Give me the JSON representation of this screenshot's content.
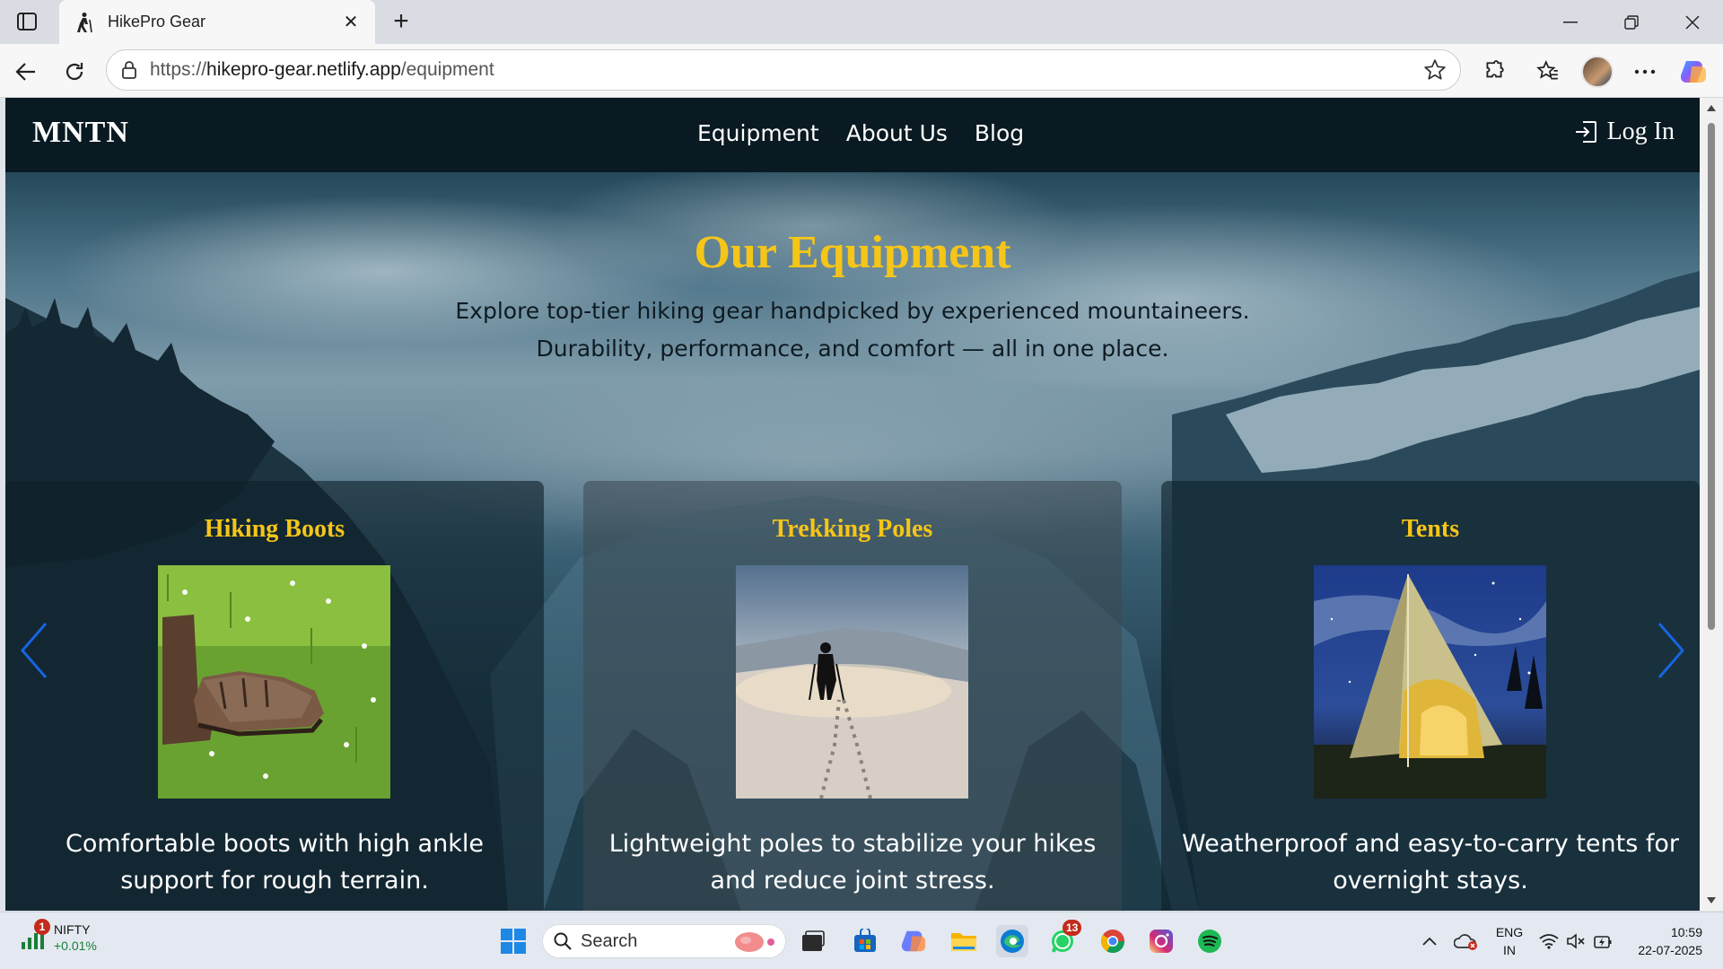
{
  "browser": {
    "tab_title": "HikePro Gear",
    "url_scheme": "https://",
    "url_host": "hikepro-gear.netlify.app",
    "url_path": "/equipment"
  },
  "site": {
    "logo": "MNTN",
    "nav": [
      "Equipment",
      "About Us",
      "Blog"
    ],
    "login_label": "Log In"
  },
  "hero": {
    "title": "Our Equipment",
    "subtitle_line1": "Explore top-tier hiking gear handpicked by experienced mountaineers.",
    "subtitle_line2": "Durability, performance, and comfort — all in one place."
  },
  "cards": [
    {
      "title": "Hiking Boots",
      "desc": "Comfortable boots with high ankle support for rough terrain."
    },
    {
      "title": "Trekking Poles",
      "desc": "Lightweight poles to stabilize your hikes and reduce joint stress."
    },
    {
      "title": "Tents",
      "desc": "Weatherproof and easy-to-carry tents for overnight stays."
    }
  ],
  "taskbar": {
    "nifty_label": "NIFTY",
    "nifty_change": "+0.01%",
    "nifty_badge": "1",
    "search_placeholder": "Search",
    "whatsapp_badge": "13",
    "lang_line1": "ENG",
    "lang_line2": "IN",
    "time": "10:59",
    "date": "22-07-2025"
  },
  "colors": {
    "accent": "#f5c518",
    "navbar": "#0a1a22",
    "arrow": "#1565e0"
  }
}
